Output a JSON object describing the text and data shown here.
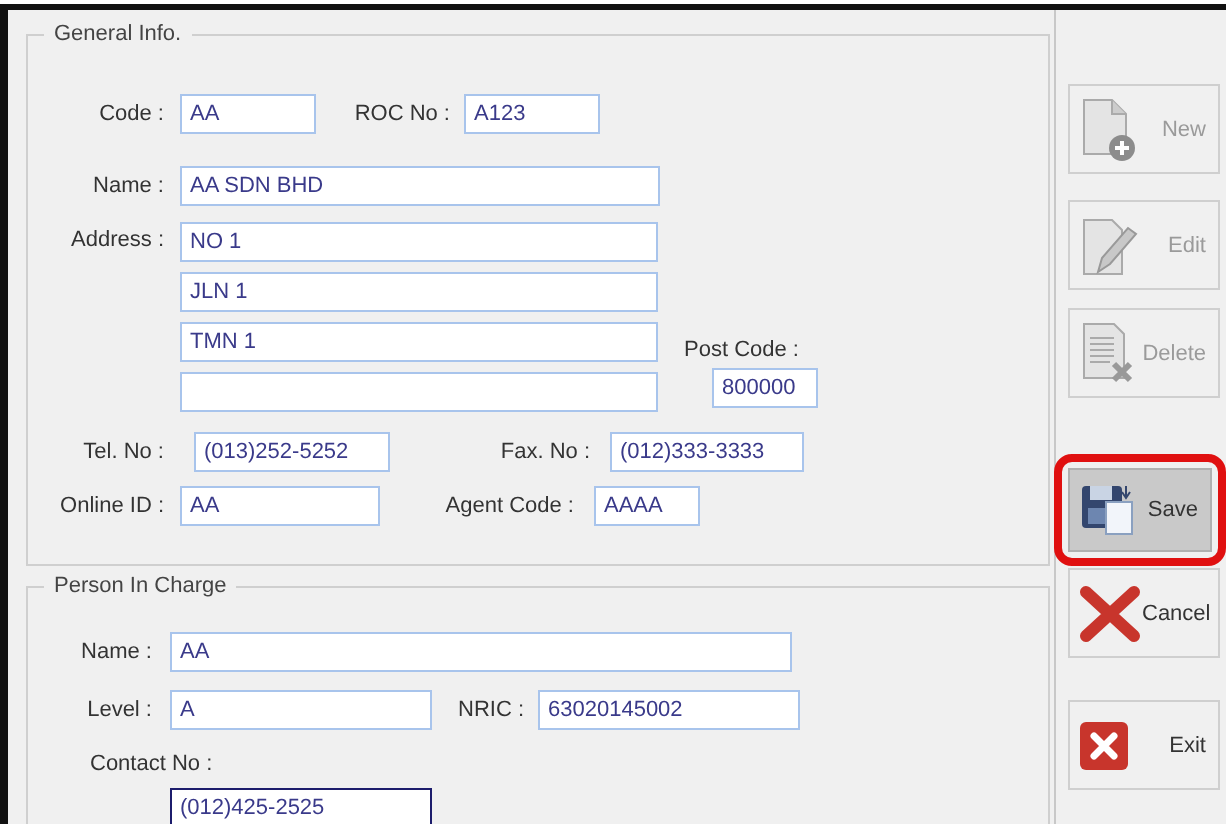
{
  "general": {
    "legend": "General Info.",
    "code": {
      "label": "Code :",
      "value": "AA"
    },
    "roc_no": {
      "label": "ROC No :",
      "value": "A123"
    },
    "name": {
      "label": "Name :",
      "value": "AA SDN BHD"
    },
    "address": {
      "label": "Address :",
      "lines": [
        "NO 1",
        "JLN 1",
        "TMN 1"
      ]
    },
    "post_code": {
      "label": "Post Code :",
      "value": "800000"
    },
    "tel_no": {
      "label": "Tel. No :",
      "value": "(013)252-5252"
    },
    "fax_no": {
      "label": "Fax. No :",
      "value": "(012)333-3333"
    },
    "online_id": {
      "label": "Online ID :",
      "value": "AA"
    },
    "agent_code": {
      "label": "Agent Code :",
      "value": "AAAA"
    }
  },
  "person_in_charge": {
    "legend": "Person In Charge",
    "name": {
      "label": "Name :",
      "value": "AA"
    },
    "level": {
      "label": "Level :",
      "value": "A"
    },
    "nric": {
      "label": "NRIC :",
      "value": "63020145002"
    },
    "contact_no": {
      "label": "Contact No :",
      "value": "(012)425-2525",
      "focused": true
    }
  },
  "buttons": [
    {
      "kind": "new",
      "label": "New",
      "disabled": true,
      "highlighted": false
    },
    {
      "kind": "edit",
      "label": "Edit",
      "disabled": true,
      "highlighted": false
    },
    {
      "kind": "delete",
      "label": "Delete",
      "disabled": true,
      "highlighted": false
    },
    {
      "kind": "save",
      "label": "Save",
      "disabled": false,
      "highlighted": true
    },
    {
      "kind": "cancel",
      "label": "Cancel",
      "disabled": false,
      "highlighted": false
    },
    {
      "kind": "exit",
      "label": "Exit",
      "disabled": false,
      "highlighted": false
    }
  ]
}
